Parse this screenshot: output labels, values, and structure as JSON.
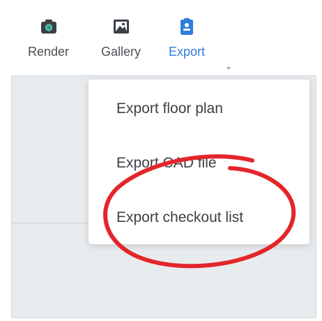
{
  "toolbar": {
    "items": [
      {
        "label": "Render",
        "icon": "camera-icon",
        "color": "#3a4047"
      },
      {
        "label": "Gallery",
        "icon": "gallery-icon",
        "color": "#3a4047"
      },
      {
        "label": "Export",
        "icon": "export-icon",
        "color": "#2f7de1",
        "active": true
      }
    ]
  },
  "export_menu": {
    "items": [
      {
        "label": "Export floor plan"
      },
      {
        "label": "Export CAD file"
      },
      {
        "label": "Export checkout list"
      }
    ]
  },
  "colors": {
    "accent": "#2f7de1",
    "annotation": "#e3262a",
    "canvas": "#e7ebee"
  }
}
